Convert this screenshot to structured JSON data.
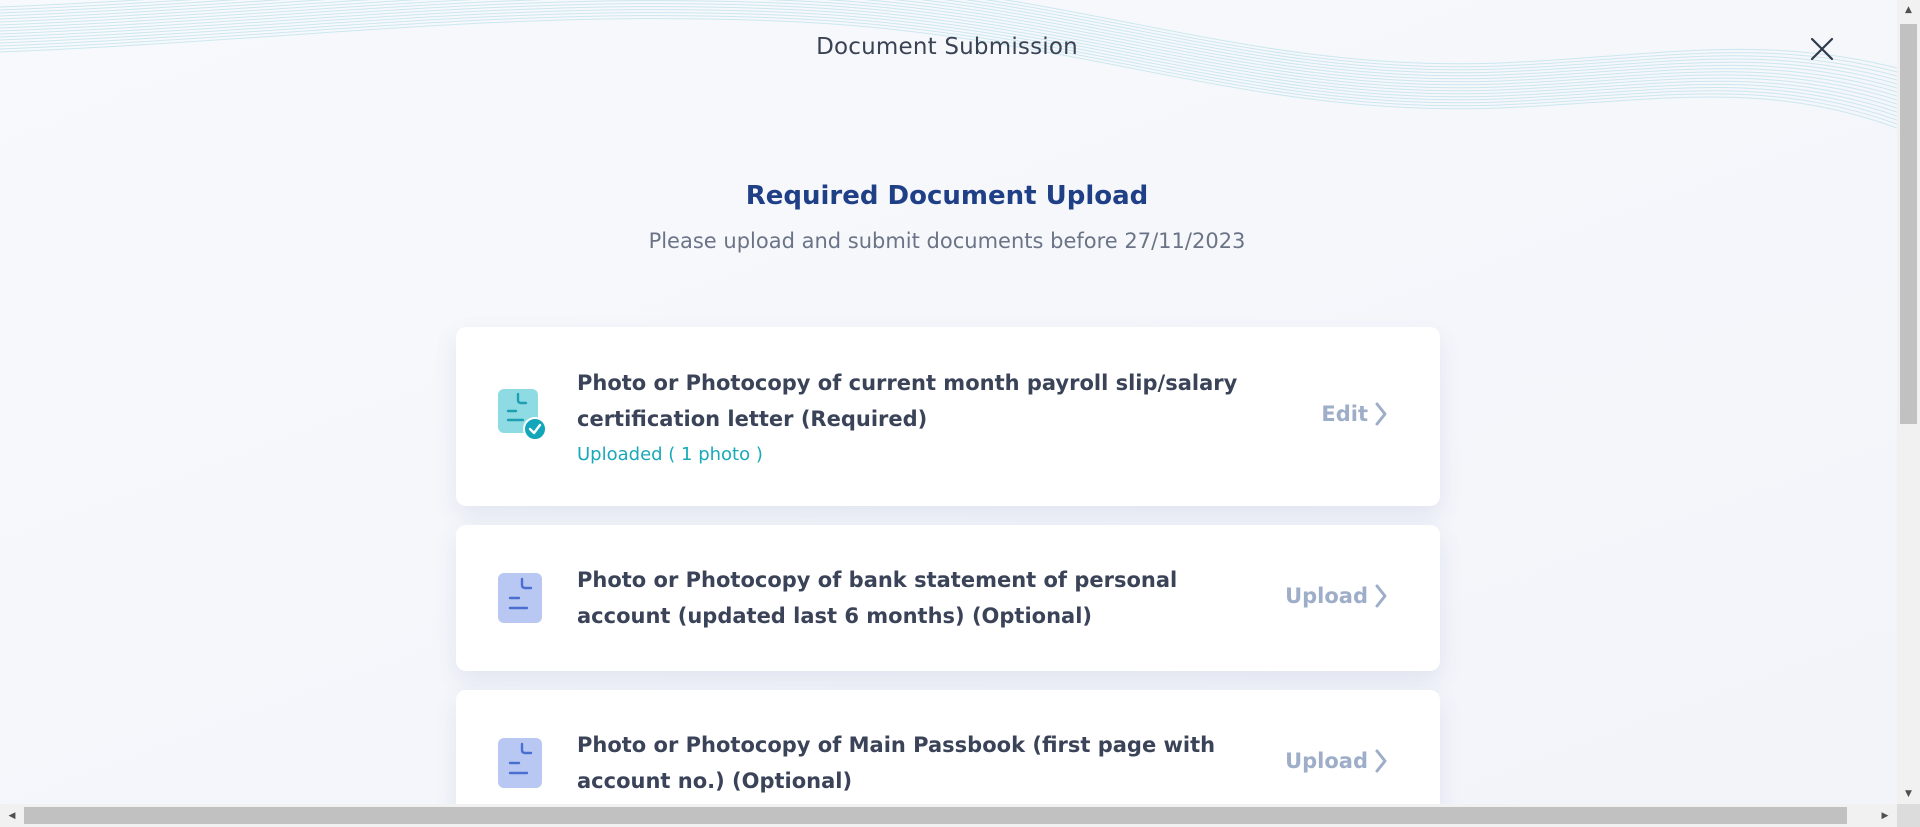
{
  "header": {
    "title": "Document Submission",
    "close_icon": "close-icon"
  },
  "main": {
    "heading": "Required Document Upload",
    "subheading": "Please upload and submit documents before 27/11/2023"
  },
  "documents": [
    {
      "title": "Photo or Photocopy of current month payroll slip/salary certification letter (Required)",
      "status": "Uploaded ( 1 photo )",
      "action": "Edit",
      "icon": "document-uploaded-icon"
    },
    {
      "title": "Photo or Photocopy of bank statement of personal account (updated last 6 months) (Optional)",
      "status": "",
      "action": "Upload",
      "icon": "document-icon"
    },
    {
      "title": "Photo or Photocopy of Main Passbook (first page with account no.) (Optional)",
      "status": "",
      "action": "Upload",
      "icon": "document-icon"
    }
  ],
  "colors": {
    "heading": "#1f3f86",
    "status_uploaded": "#19a9b8",
    "action_text": "#9eadc8",
    "icon_uploaded_bg": "#8fdbe3",
    "icon_pending_bg": "#b9c8f2"
  },
  "scrollbars": {
    "up_arrow": "▲",
    "down_arrow": "▼",
    "left_arrow": "◀",
    "right_arrow": "▶"
  }
}
